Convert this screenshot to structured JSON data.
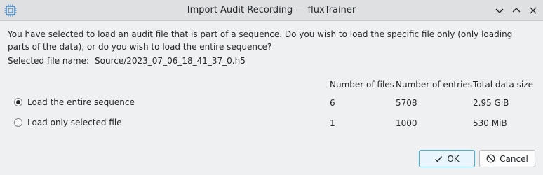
{
  "window": {
    "title": "Import Audit Recording — fluxTrainer",
    "app_icon": "chip-icon",
    "controls": [
      "minimize-icon",
      "maximize-icon",
      "close-icon"
    ]
  },
  "message": "You have selected to load an audit file that is part of a sequence. Do you wish to load the specific file only (only loading parts of the data), or do you wish to load the entire sequence?",
  "selected_file": {
    "label": "Selected file name:",
    "value": "Source/2023_07_06_18_41_37_0.h5"
  },
  "table": {
    "headers": [
      "Number of files",
      "Number of entries",
      "Total data size"
    ],
    "options": [
      {
        "label": "Load the entire sequence",
        "checked": true,
        "files": "6",
        "entries": "5708",
        "size": "2.95 GiB"
      },
      {
        "label": "Load only selected file",
        "checked": false,
        "files": "1",
        "entries": "1000",
        "size": "530 MiB"
      }
    ]
  },
  "buttons": {
    "ok": "OK",
    "cancel": "Cancel"
  },
  "colors": {
    "accent": "#3daee9",
    "background": "#eff0f1",
    "titlebar": "#dee0e2"
  }
}
